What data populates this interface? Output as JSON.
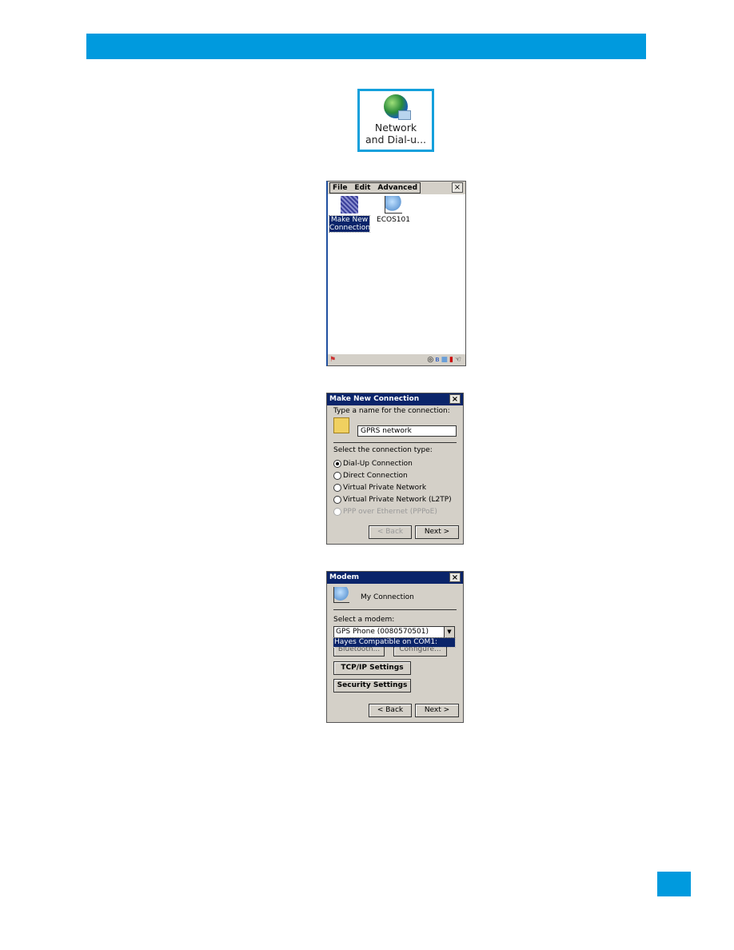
{
  "colors": {
    "accent": "#009ade",
    "titlebar": "#0a246a"
  },
  "desktop_icon": {
    "icon": "globe-network-icon",
    "line1": "Network",
    "line2": "and Dial-u..."
  },
  "explorer": {
    "menu": [
      "File",
      "Edit",
      "Advanced"
    ],
    "close": "×",
    "items": [
      {
        "label_line1": "Make New",
        "label_line2": "Connection",
        "icon": "make-connection-icon"
      },
      {
        "label": "ECOS101",
        "icon": "network-connection-icon"
      }
    ],
    "tray_icons": [
      "start-icon",
      "clock-icon",
      "bluetooth-icon",
      "network-icon",
      "battery-icon",
      "input-icon"
    ]
  },
  "make_new": {
    "title": "Make New Connection",
    "close": "×",
    "name_label": "Type a name for the connection:",
    "name_value": "GPRS network",
    "type_label": "Select the connection type:",
    "options": [
      {
        "label": "Dial-Up Connection",
        "selected": true,
        "enabled": true
      },
      {
        "label": "Direct Connection",
        "selected": false,
        "enabled": true
      },
      {
        "label": "Virtual Private Network",
        "selected": false,
        "enabled": true
      },
      {
        "label": "Virtual Private Network (L2TP)",
        "selected": false,
        "enabled": true
      },
      {
        "label": "PPP over Ethernet (PPPoE)",
        "selected": false,
        "enabled": false
      }
    ],
    "back": "< Back",
    "next": "Next >"
  },
  "modem": {
    "title": "Modem",
    "close": "×",
    "connection_name": "My Connection",
    "select_label": "Select a modem:",
    "selected": "GPS Phone (0080570501)",
    "dropdown_option": "Hayes Compatible on COM1:",
    "hidden_buttons": [
      "Bluetooth...",
      "Configure..."
    ],
    "tcpip": "TCP/IP Settings",
    "security": "Security Settings",
    "back": "< Back",
    "next": "Next >"
  }
}
